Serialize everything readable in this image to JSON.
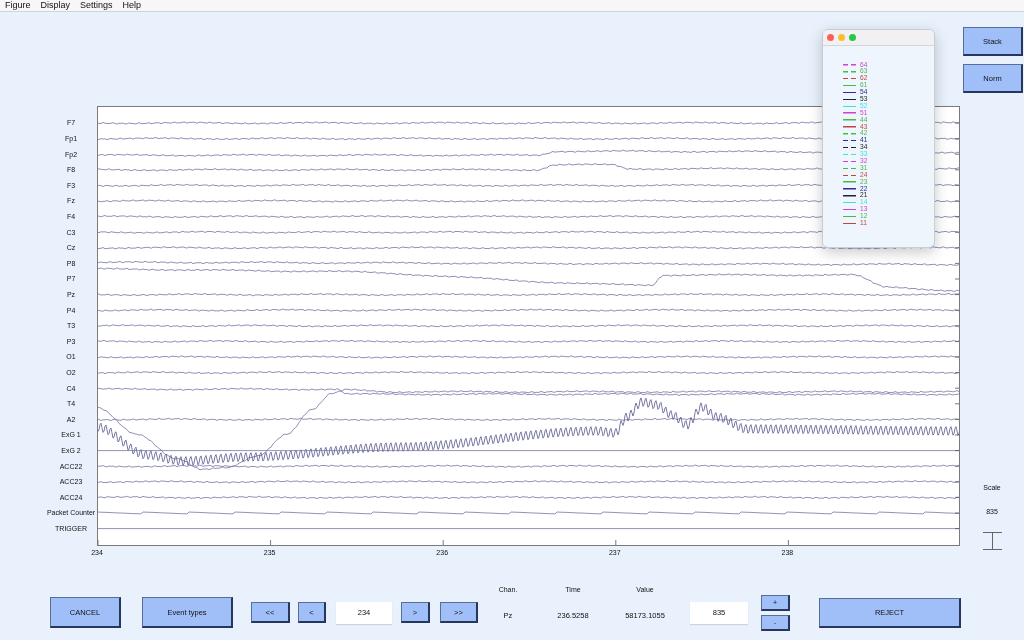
{
  "menu_bar": {
    "items": [
      "Figure",
      "Display",
      "Settings",
      "Help"
    ]
  },
  "side_buttons": [
    "Stack",
    "Norm"
  ],
  "plot": {
    "channels": [
      "F7",
      "Fp1",
      "Fp2",
      "F8",
      "F3",
      "Fz",
      "F4",
      "C3",
      "Cz",
      "P8",
      "P7",
      "Pz",
      "P4",
      "T3",
      "P3",
      "O1",
      "O2",
      "C4",
      "T4",
      "A2",
      "ExG 1",
      "ExG 2",
      "ACC22",
      "ACC23",
      "ACC24",
      "Packet Counter",
      "TRIGGER"
    ],
    "x_ticks": [
      "234",
      "235",
      "236",
      "237",
      "238"
    ]
  },
  "legend": {
    "items": [
      {
        "label": "64",
        "color": "#cc44cc",
        "kind": "dashed"
      },
      {
        "label": "63",
        "color": "#44bb44",
        "kind": "dashed"
      },
      {
        "label": "62",
        "color": "#bb4444",
        "kind": "dashed"
      },
      {
        "label": "61",
        "color": "#44bb44",
        "kind": "solid"
      },
      {
        "label": "54",
        "color": "#2a2a99",
        "kind": "solid"
      },
      {
        "label": "53",
        "color": "#222222",
        "kind": "solid"
      },
      {
        "label": "52",
        "color": "#44dddd",
        "kind": "solid"
      },
      {
        "label": "51",
        "color": "#cc44cc",
        "kind": "solid"
      },
      {
        "label": "44",
        "color": "#44bb44",
        "kind": "solid"
      },
      {
        "label": "43",
        "color": "#bb4444",
        "kind": "solid"
      },
      {
        "label": "42",
        "color": "#44bb44",
        "kind": "dashed"
      },
      {
        "label": "41",
        "color": "#2a2a99",
        "kind": "dashed"
      },
      {
        "label": "34",
        "color": "#222222",
        "kind": "dashed"
      },
      {
        "label": "33",
        "color": "#44dddd",
        "kind": "dashed"
      },
      {
        "label": "32",
        "color": "#cc44cc",
        "kind": "dashed"
      },
      {
        "label": "31",
        "color": "#44bb44",
        "kind": "dashed"
      },
      {
        "label": "24",
        "color": "#bb4444",
        "kind": "dashed"
      },
      {
        "label": "23",
        "color": "#44bb44",
        "kind": "solid"
      },
      {
        "label": "22",
        "color": "#2a2a99",
        "kind": "solid"
      },
      {
        "label": "21",
        "color": "#222222",
        "kind": "solid"
      },
      {
        "label": "14",
        "color": "#44dddd",
        "kind": "solid"
      },
      {
        "label": "13",
        "color": "#cc44cc",
        "kind": "solid"
      },
      {
        "label": "12",
        "color": "#44bb44",
        "kind": "solid"
      },
      {
        "label": "11",
        "color": "#bb4444",
        "kind": "solid"
      }
    ]
  },
  "scale": {
    "label": "Scale",
    "value": "835"
  },
  "controls": {
    "cancel": "CANCEL",
    "event_types": "Event types",
    "first": "<<",
    "previous": "<",
    "position": {
      "value": "234"
    },
    "next": ">",
    "last": ">>",
    "readout": [
      {
        "heading": "Chan.",
        "value": "Pz"
      },
      {
        "heading": "Time",
        "value": "236.5258"
      },
      {
        "heading": "Value",
        "value": "58173.1055"
      }
    ],
    "scale_field": {
      "value": "835"
    },
    "increase": "+",
    "decrease": "-",
    "reject": "REJECT"
  }
}
